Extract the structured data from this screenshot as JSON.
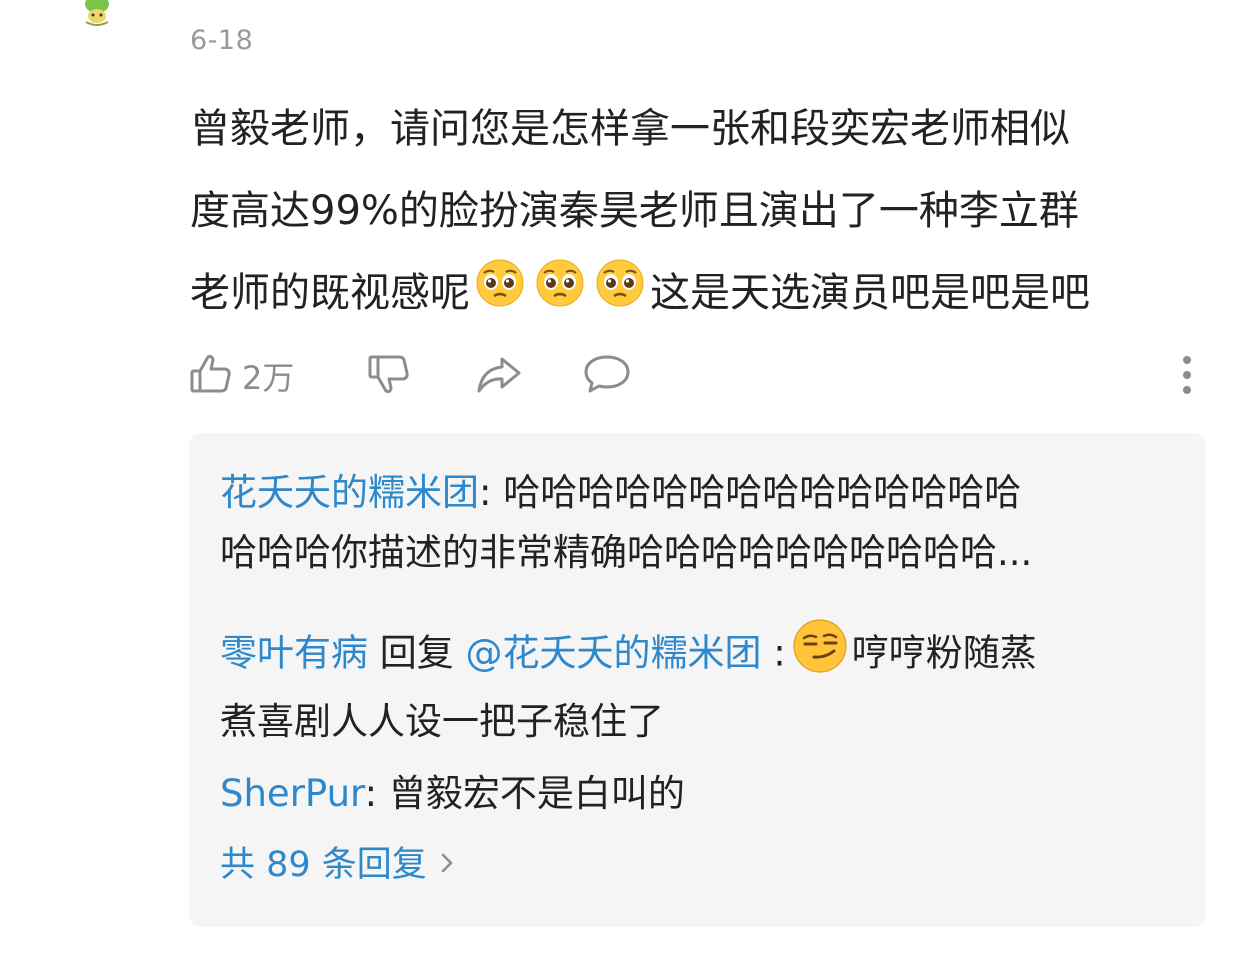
{
  "comment": {
    "date": "6-18",
    "lines": {
      "l1": "曾毅老师，请问您是怎样拿一张和段奕宏老师相似",
      "l2": "度高达99%的脸扮演秦昊老师且演出了一种李立群",
      "l3_before": "老师的既视感呢",
      "l3_after": "这是天选演员吧是吧是吧"
    },
    "emoji_icon": "pleading-face-emoji",
    "like_count": "2万"
  },
  "replies": [
    {
      "user": "花夭夭的糯米团",
      "sep": ": ",
      "line1": "哈哈哈哈哈哈哈哈哈哈哈哈哈哈",
      "line2": "哈哈哈你描述的非常精确哈哈哈哈哈哈哈哈哈哈..."
    },
    {
      "user": "零叶有病",
      "reply_word": " 回复 ",
      "target": "@花夭夭的糯米团",
      "sep": " :",
      "emoji_icon": "smirk-face-emoji",
      "line1": "哼哼粉随蒸",
      "line2": "煮喜剧人人设一把子稳住了"
    },
    {
      "user": "SherPur",
      "sep": ": ",
      "line1": "曾毅宏不是白叫的"
    }
  ],
  "all_replies_label": "共 89 条回复",
  "colors": {
    "link": "#2e88cc",
    "text": "#222222",
    "muted": "#9a9a9a",
    "reply_bg": "#f5f5f5"
  }
}
